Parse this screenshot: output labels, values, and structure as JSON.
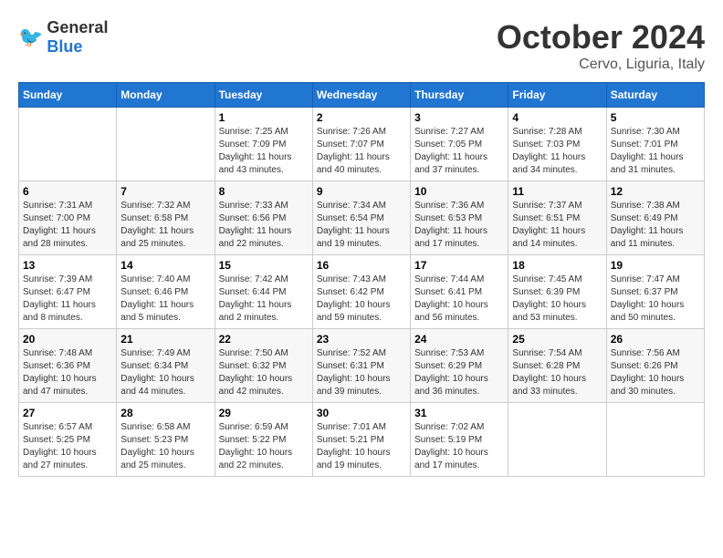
{
  "logo": {
    "general": "General",
    "blue": "Blue"
  },
  "title": "October 2024",
  "subtitle": "Cervo, Liguria, Italy",
  "weekdays": [
    "Sunday",
    "Monday",
    "Tuesday",
    "Wednesday",
    "Thursday",
    "Friday",
    "Saturday"
  ],
  "weeks": [
    [
      {
        "day": null,
        "detail": null
      },
      {
        "day": null,
        "detail": null
      },
      {
        "day": "1",
        "detail": "Sunrise: 7:25 AM\nSunset: 7:09 PM\nDaylight: 11 hours and 43 minutes."
      },
      {
        "day": "2",
        "detail": "Sunrise: 7:26 AM\nSunset: 7:07 PM\nDaylight: 11 hours and 40 minutes."
      },
      {
        "day": "3",
        "detail": "Sunrise: 7:27 AM\nSunset: 7:05 PM\nDaylight: 11 hours and 37 minutes."
      },
      {
        "day": "4",
        "detail": "Sunrise: 7:28 AM\nSunset: 7:03 PM\nDaylight: 11 hours and 34 minutes."
      },
      {
        "day": "5",
        "detail": "Sunrise: 7:30 AM\nSunset: 7:01 PM\nDaylight: 11 hours and 31 minutes."
      }
    ],
    [
      {
        "day": "6",
        "detail": "Sunrise: 7:31 AM\nSunset: 7:00 PM\nDaylight: 11 hours and 28 minutes."
      },
      {
        "day": "7",
        "detail": "Sunrise: 7:32 AM\nSunset: 6:58 PM\nDaylight: 11 hours and 25 minutes."
      },
      {
        "day": "8",
        "detail": "Sunrise: 7:33 AM\nSunset: 6:56 PM\nDaylight: 11 hours and 22 minutes."
      },
      {
        "day": "9",
        "detail": "Sunrise: 7:34 AM\nSunset: 6:54 PM\nDaylight: 11 hours and 19 minutes."
      },
      {
        "day": "10",
        "detail": "Sunrise: 7:36 AM\nSunset: 6:53 PM\nDaylight: 11 hours and 17 minutes."
      },
      {
        "day": "11",
        "detail": "Sunrise: 7:37 AM\nSunset: 6:51 PM\nDaylight: 11 hours and 14 minutes."
      },
      {
        "day": "12",
        "detail": "Sunrise: 7:38 AM\nSunset: 6:49 PM\nDaylight: 11 hours and 11 minutes."
      }
    ],
    [
      {
        "day": "13",
        "detail": "Sunrise: 7:39 AM\nSunset: 6:47 PM\nDaylight: 11 hours and 8 minutes."
      },
      {
        "day": "14",
        "detail": "Sunrise: 7:40 AM\nSunset: 6:46 PM\nDaylight: 11 hours and 5 minutes."
      },
      {
        "day": "15",
        "detail": "Sunrise: 7:42 AM\nSunset: 6:44 PM\nDaylight: 11 hours and 2 minutes."
      },
      {
        "day": "16",
        "detail": "Sunrise: 7:43 AM\nSunset: 6:42 PM\nDaylight: 10 hours and 59 minutes."
      },
      {
        "day": "17",
        "detail": "Sunrise: 7:44 AM\nSunset: 6:41 PM\nDaylight: 10 hours and 56 minutes."
      },
      {
        "day": "18",
        "detail": "Sunrise: 7:45 AM\nSunset: 6:39 PM\nDaylight: 10 hours and 53 minutes."
      },
      {
        "day": "19",
        "detail": "Sunrise: 7:47 AM\nSunset: 6:37 PM\nDaylight: 10 hours and 50 minutes."
      }
    ],
    [
      {
        "day": "20",
        "detail": "Sunrise: 7:48 AM\nSunset: 6:36 PM\nDaylight: 10 hours and 47 minutes."
      },
      {
        "day": "21",
        "detail": "Sunrise: 7:49 AM\nSunset: 6:34 PM\nDaylight: 10 hours and 44 minutes."
      },
      {
        "day": "22",
        "detail": "Sunrise: 7:50 AM\nSunset: 6:32 PM\nDaylight: 10 hours and 42 minutes."
      },
      {
        "day": "23",
        "detail": "Sunrise: 7:52 AM\nSunset: 6:31 PM\nDaylight: 10 hours and 39 minutes."
      },
      {
        "day": "24",
        "detail": "Sunrise: 7:53 AM\nSunset: 6:29 PM\nDaylight: 10 hours and 36 minutes."
      },
      {
        "day": "25",
        "detail": "Sunrise: 7:54 AM\nSunset: 6:28 PM\nDaylight: 10 hours and 33 minutes."
      },
      {
        "day": "26",
        "detail": "Sunrise: 7:56 AM\nSunset: 6:26 PM\nDaylight: 10 hours and 30 minutes."
      }
    ],
    [
      {
        "day": "27",
        "detail": "Sunrise: 6:57 AM\nSunset: 5:25 PM\nDaylight: 10 hours and 27 minutes."
      },
      {
        "day": "28",
        "detail": "Sunrise: 6:58 AM\nSunset: 5:23 PM\nDaylight: 10 hours and 25 minutes."
      },
      {
        "day": "29",
        "detail": "Sunrise: 6:59 AM\nSunset: 5:22 PM\nDaylight: 10 hours and 22 minutes."
      },
      {
        "day": "30",
        "detail": "Sunrise: 7:01 AM\nSunset: 5:21 PM\nDaylight: 10 hours and 19 minutes."
      },
      {
        "day": "31",
        "detail": "Sunrise: 7:02 AM\nSunset: 5:19 PM\nDaylight: 10 hours and 17 minutes."
      },
      {
        "day": null,
        "detail": null
      },
      {
        "day": null,
        "detail": null
      }
    ]
  ]
}
